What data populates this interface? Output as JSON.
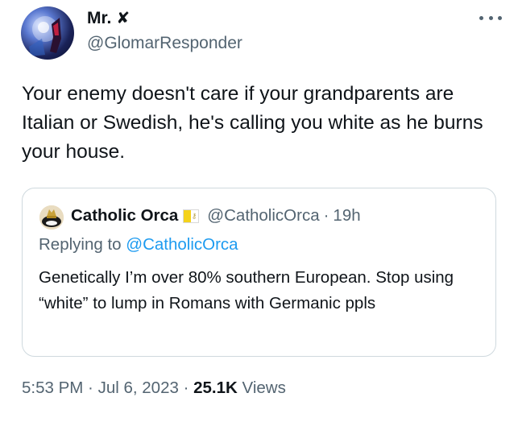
{
  "author": {
    "display_name": "Mr.",
    "badge": "✘",
    "handle": "@GlomarResponder"
  },
  "tweet": {
    "text": "Your enemy doesn't care if your grandparents are Italian or Swedish, he's calling you white as he burns your house."
  },
  "quote": {
    "display_name": "Catholic Orca",
    "handle": "@CatholicOrca",
    "separator": "·",
    "time": "19h",
    "replying_prefix": "Replying to",
    "replying_handle": "@CatholicOrca",
    "text": "Genetically I’m over 80% southern European. Stop using “white” to lump in Romans with Germanic ppls"
  },
  "meta": {
    "time": "5:53 PM",
    "sep1": " · ",
    "date": "Jul 6, 2023",
    "sep2": " · ",
    "views_count": "25.1K",
    "views_label": " Views"
  },
  "icons": {
    "more": "more-horizontal-icon",
    "flag": "vatican-flag-icon",
    "badge": "x-mark-icon"
  },
  "colors": {
    "text_primary": "#0f1419",
    "text_secondary": "#536471",
    "link": "#1d9bf0",
    "border": "#cfd9de"
  }
}
